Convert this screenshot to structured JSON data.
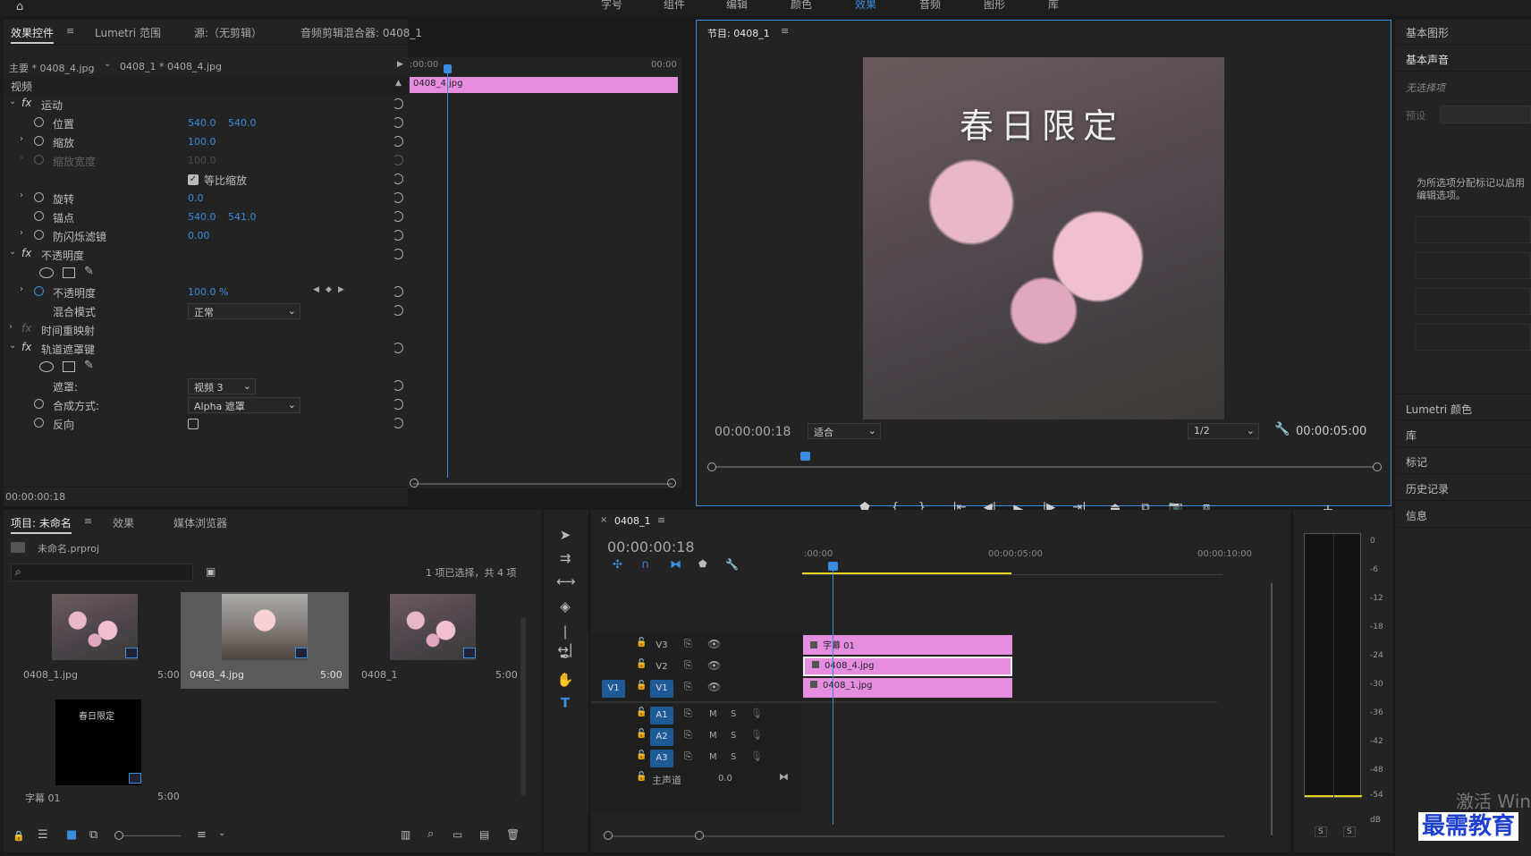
{
  "top_menu": {
    "items": [
      "字号",
      "组件",
      "编辑",
      "颜色",
      "效果",
      "音频",
      "图形",
      "库"
    ]
  },
  "effect_controls": {
    "tabs": [
      "效果控件",
      "Lumetri 范围",
      "源:（无剪辑）",
      "音频剪辑混合器: 0408_1"
    ],
    "master_clip": "主要 * 0408_4.jpg",
    "sequence_clip": "0408_1 * 0408_4.jpg",
    "timeline_start": ":00:00",
    "timeline_end": "00:00",
    "clip_label": "0408_4.jpg",
    "video_header": "视频",
    "motion": "运动",
    "position": {
      "label": "位置",
      "x": "540.0",
      "y": "540.0"
    },
    "scale": {
      "label": "缩放",
      "value": "100.0"
    },
    "scale_width": {
      "label": "缩放宽度",
      "value": "100.0"
    },
    "uniform_scale": "等比缩放",
    "rotation": {
      "label": "旋转",
      "value": "0.0"
    },
    "anchor": {
      "label": "锚点",
      "x": "540.0",
      "y": "541.0"
    },
    "anti_flicker": {
      "label": "防闪烁滤镜",
      "value": "0.00"
    },
    "opacity_group": "不透明度",
    "opacity": {
      "label": "不透明度",
      "value": "100.0 %"
    },
    "blend_mode": {
      "label": "混合模式",
      "value": "正常"
    },
    "time_remap": "时间重映射",
    "track_matte": "轨道遮罩键",
    "matte": {
      "label": "遮罩:",
      "value": "视频 3"
    },
    "composite": {
      "label": "合成方式:",
      "value": "Alpha 遮罩"
    },
    "reverse": "反向",
    "timecode": "00:00:00:18"
  },
  "program_monitor": {
    "title": "节目: 0408_1",
    "overlay_text": "春日限定",
    "timecode": "00:00:00:18",
    "fit": "适合",
    "resolution": "1/2",
    "duration": "00:00:05:00"
  },
  "right_panels": [
    "基本图形",
    "基本声音",
    "无选择项",
    "预设",
    "为所选项分配标记以启用编辑选项。",
    "Lumetri 颜色",
    "库",
    "标记",
    "历史记录",
    "信息"
  ],
  "project": {
    "tabs": [
      "项目: 未命名",
      "效果",
      "媒体浏览器"
    ],
    "file": "未命名.prproj",
    "selection": "1 项已选择，共 4 项",
    "items": [
      {
        "name": "0408_1.jpg",
        "dur": "5:00"
      },
      {
        "name": "0408_4.jpg",
        "dur": "5:00"
      },
      {
        "name": "0408_1",
        "dur": "5:00"
      },
      {
        "name": "字幕 01",
        "dur": "5:00"
      }
    ],
    "caption_thumb": "春日限定"
  },
  "timeline": {
    "tab": "0408_1",
    "timecode": "00:00:00:18",
    "ruler": [
      ":00:00",
      "00:00:05:00",
      "00:00:10:00"
    ],
    "video_tracks": [
      "V3",
      "V2",
      "V1"
    ],
    "audio_tracks": [
      "A1",
      "A2",
      "A3"
    ],
    "source_v1": "V1",
    "clips": {
      "v3": "字幕 01",
      "v2": "0408_4.jpg",
      "v1": "0408_1.jpg"
    },
    "master": {
      "label": "主声道",
      "value": "0.0"
    },
    "m": "M",
    "s": "S"
  },
  "meter": {
    "labels": [
      "0",
      "-6",
      "-12",
      "-18",
      "-24",
      "-30",
      "-36",
      "-42",
      "-48",
      "-54",
      "dB"
    ],
    "solo": "S"
  },
  "watermark": {
    "activate": "激活 Win",
    "brand": "最需教育"
  },
  "colors": {
    "accent": "#3b8dde",
    "clip": "#e58ee0",
    "panel": "#232323"
  }
}
